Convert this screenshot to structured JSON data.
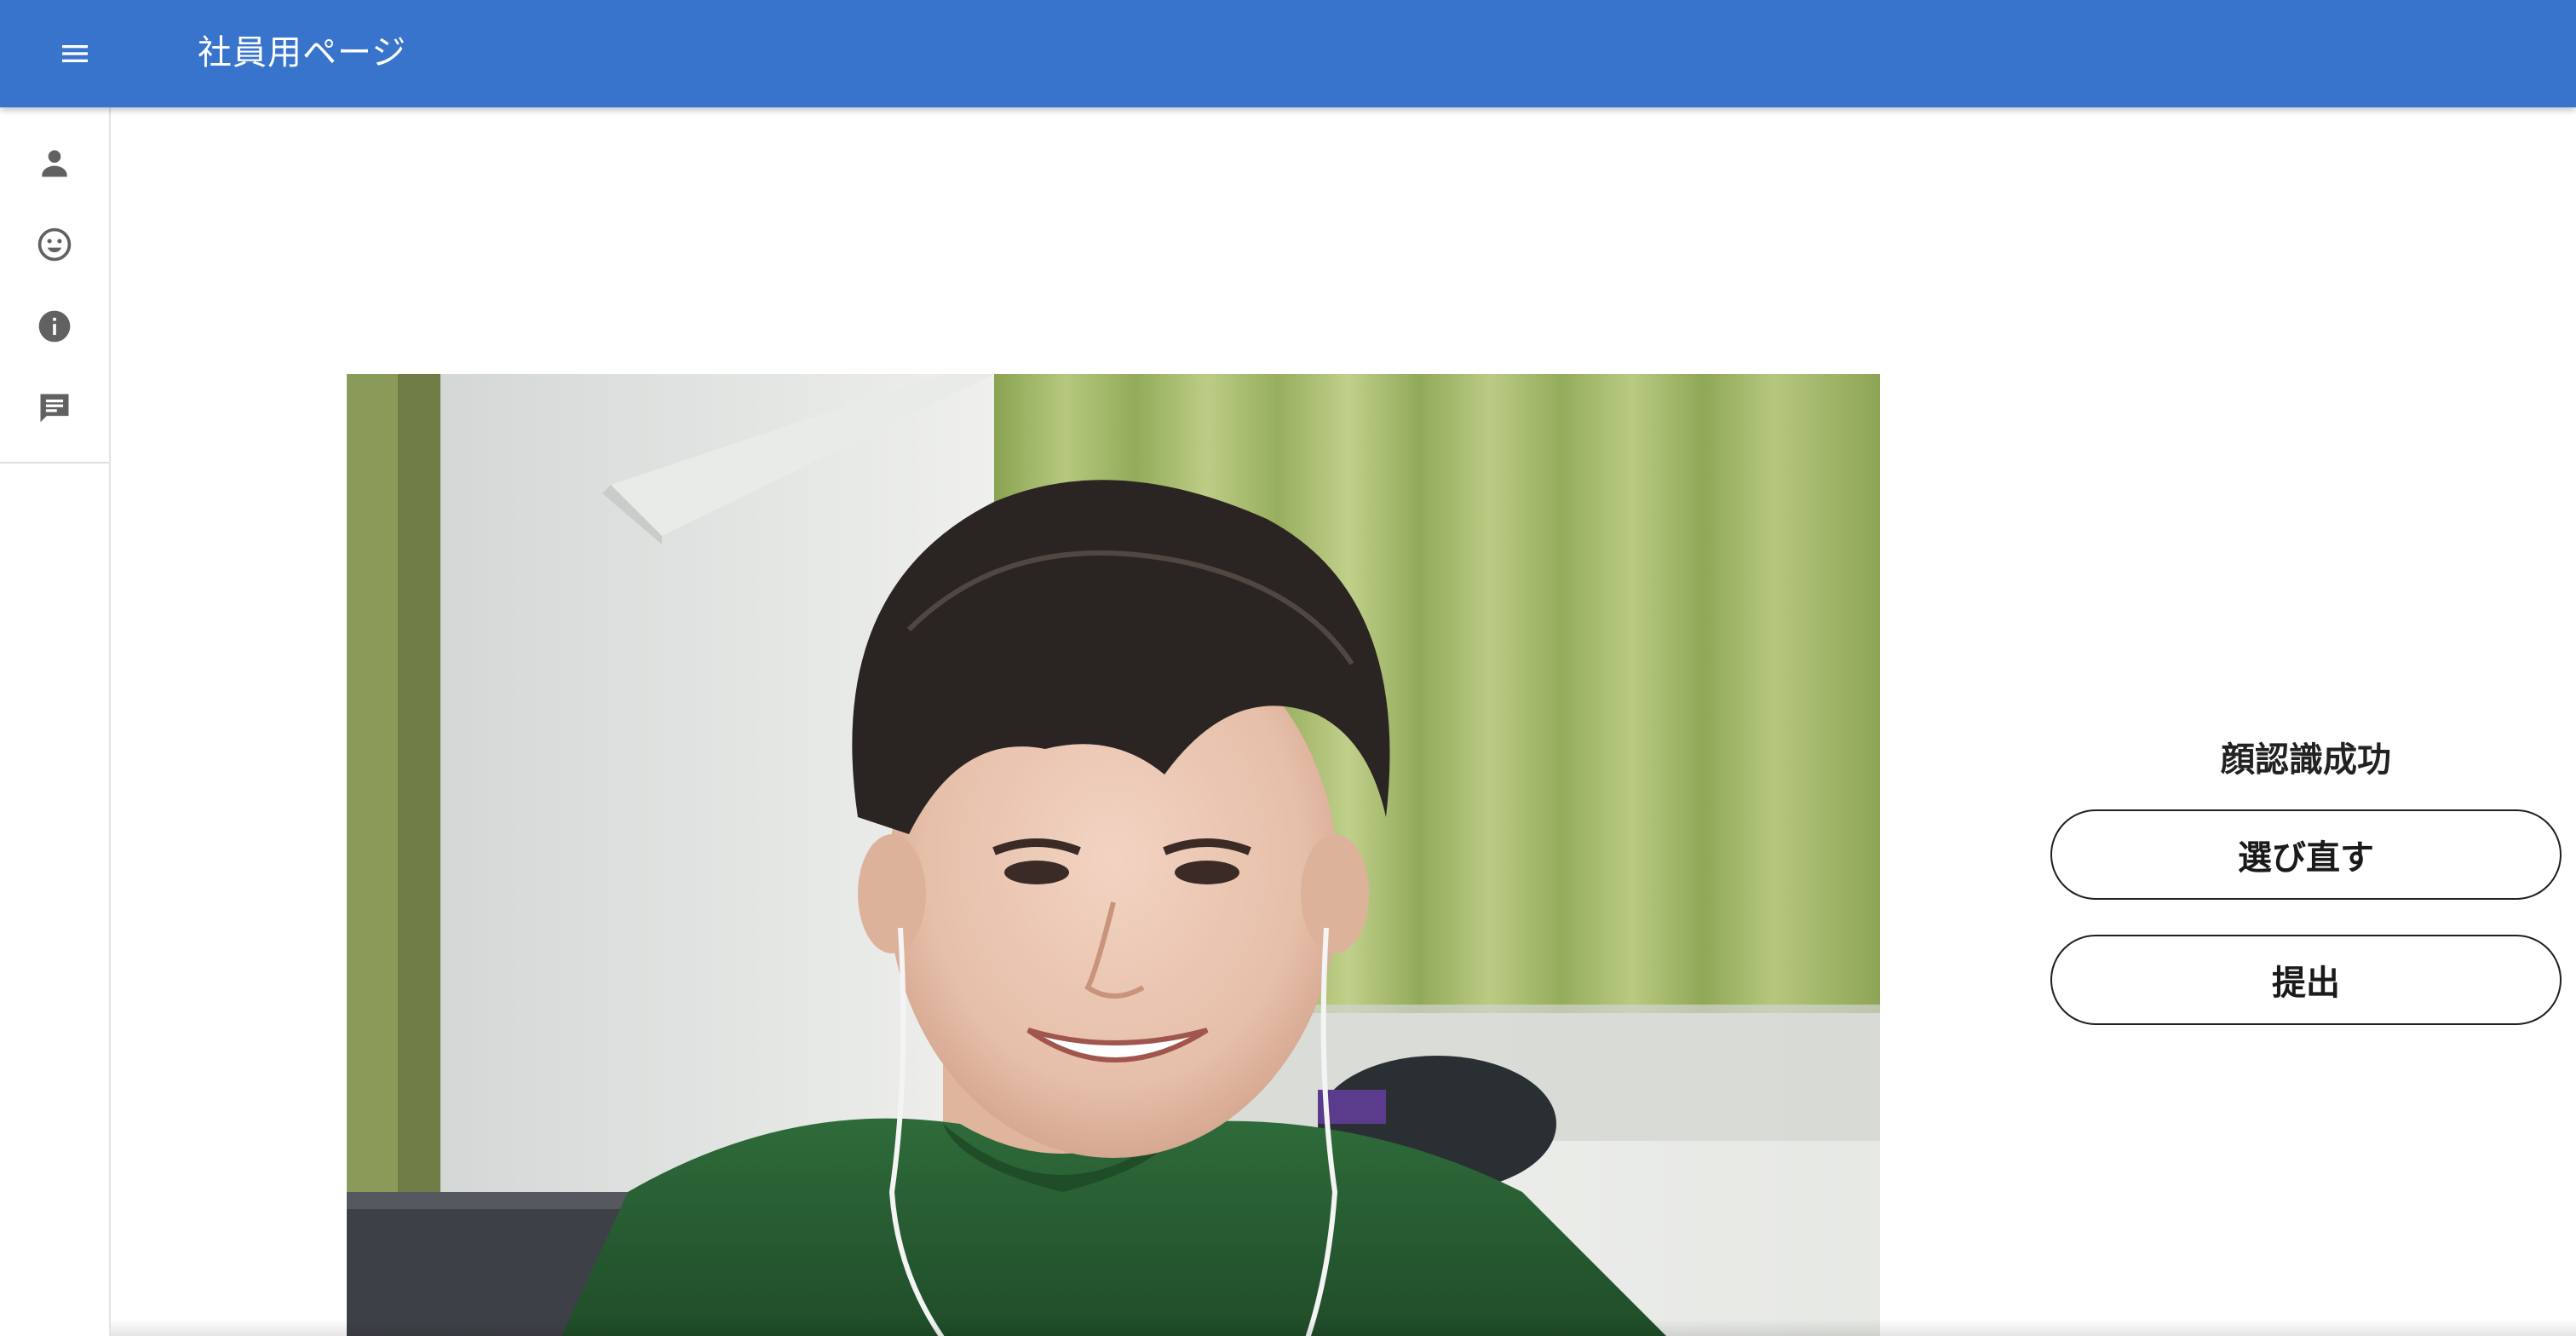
{
  "header": {
    "title": "社員用ページ"
  },
  "sidebar": {
    "items": [
      {
        "name": "profile",
        "icon": "person-icon"
      },
      {
        "name": "face-recognition",
        "icon": "smiley-face-icon"
      },
      {
        "name": "info",
        "icon": "info-icon"
      },
      {
        "name": "messages",
        "icon": "chat-icon"
      }
    ]
  },
  "camera": {
    "image_subject": "captured face photo"
  },
  "panel": {
    "status_text": "顔認識成功",
    "reselect_label": "選び直す",
    "submit_label": "提出"
  },
  "colors": {
    "app_bar": "#3874cc",
    "icon_gray": "#616161",
    "button_border": "#1f1f1f"
  }
}
